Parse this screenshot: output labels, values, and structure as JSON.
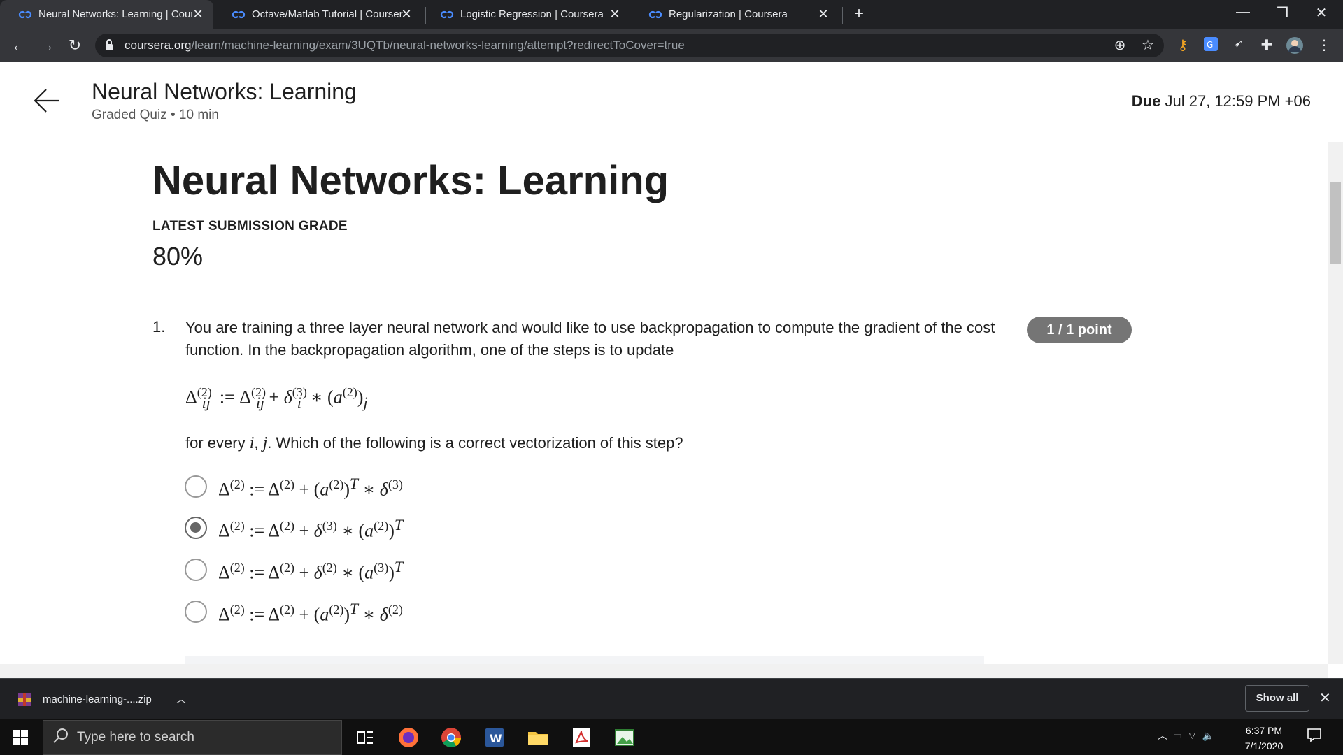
{
  "browser": {
    "tabs": [
      {
        "title": "Neural Networks: Learning | Cour",
        "active": true
      },
      {
        "title": "Octave/Matlab Tutorial | Courser",
        "active": false
      },
      {
        "title": "Logistic Regression | Coursera",
        "active": false
      },
      {
        "title": "Regularization | Coursera",
        "active": false
      }
    ],
    "new_tab": "+",
    "url_host": "coursera.org",
    "url_path": "/learn/machine-learning/exam/3UQTb/neural-networks-learning/attempt?redirectToCover=true"
  },
  "header": {
    "title": "Neural Networks: Learning",
    "subtitle": "Graded Quiz • 10 min",
    "due_label": "Due",
    "due_value": "Jul 27, 12:59 PM +06"
  },
  "main": {
    "title": "Neural Networks: Learning",
    "grade_label": "LATEST SUBMISSION GRADE",
    "grade_value": "80%",
    "question": {
      "number": "1.",
      "text": "You are training a three layer neural network and would like to use backpropagation to compute the gradient of the cost function. In the backpropagation algorithm, one of the steps is to update",
      "points": "1 / 1 point",
      "for_every_prefix": "for every ",
      "for_every_suffix": ". Which of the following is a correct vectorization of this step?",
      "selected_option": 1
    }
  },
  "downloads": {
    "file": "machine-learning-....zip",
    "show_all": "Show all"
  },
  "taskbar": {
    "search_placeholder": "Type here to search",
    "time": "6:37 PM",
    "date": "7/1/2020"
  },
  "colors": {
    "chrome_dark": "#202124",
    "chrome_toolbar": "#35363a",
    "points_badge": "#757575",
    "taskbar": "#101010"
  }
}
